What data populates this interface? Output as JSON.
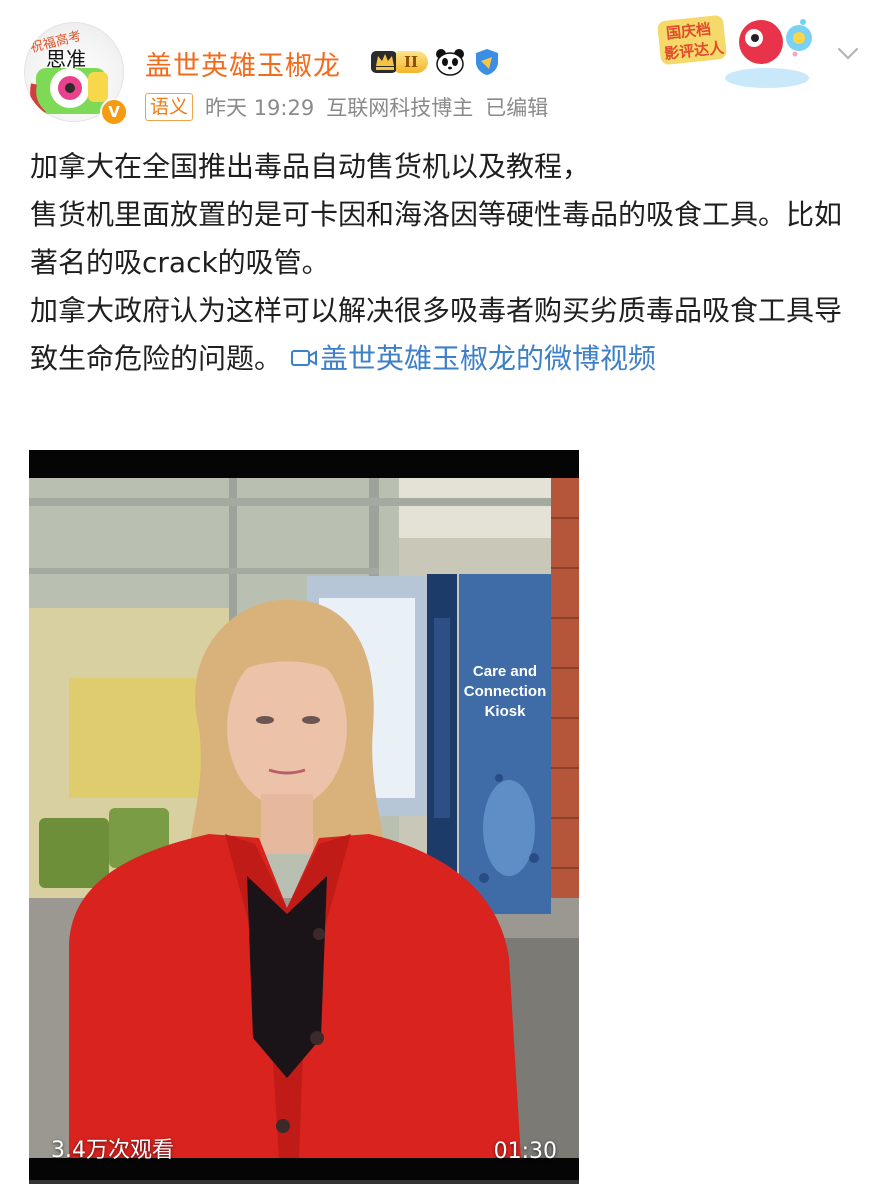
{
  "post": {
    "author": {
      "name": "盖世英雄玉椒龙",
      "level_badge": "II",
      "verified_mark": "V",
      "avatar_text": "祝福高考",
      "avatar_text2": "思准"
    },
    "meta": {
      "tag": "语义",
      "time": "昨天 19:29",
      "author_type": "互联网科技博主",
      "edited": "已编辑"
    },
    "promo_badge": {
      "line1": "国庆档",
      "line2": "影评达人"
    },
    "paragraphs": [
      "加拿大在全国推出毒品自动售货机以及教程，",
      "售货机里面放置的是可卡因和海洛因等硬性毒品的吸食工具。比如著名的吸crack的吸管。",
      "加拿大政府认为这样可以解决很多吸毒者购买劣质毒品吸食工具导致生命危险的问题。"
    ],
    "video_link_label": "盖世英雄玉椒龙的微博视频",
    "video": {
      "views": "3.4万次观看",
      "duration": "01:30",
      "progress": 0,
      "kiosk_sign": [
        "Care and",
        "Connection",
        "Kiosk"
      ]
    }
  },
  "colors": {
    "username": "#f26b1d",
    "link": "#3e80c7",
    "meta": "#8a8a8a",
    "coat": "#d9231f"
  },
  "icons": [
    "chevron-down-icon",
    "crown-icon",
    "panda-icon",
    "verified-shield-icon",
    "video-camera-icon"
  ]
}
